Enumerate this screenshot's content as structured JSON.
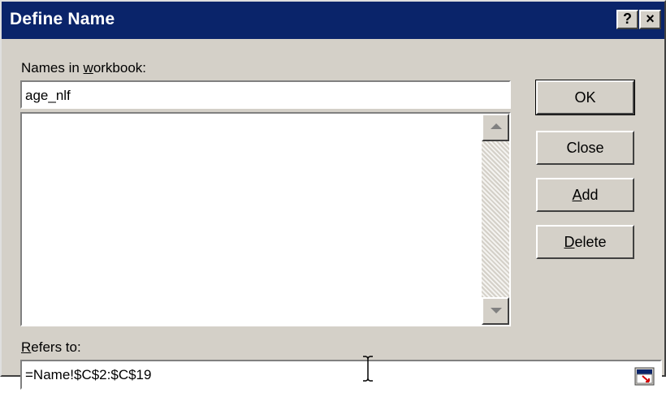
{
  "dialog": {
    "title": "Define Name",
    "help_button": "?",
    "close_button": "×"
  },
  "names_label": {
    "before": "Names in ",
    "accel": "w",
    "after": "orkbook:"
  },
  "name_input": {
    "value": "age_nlf"
  },
  "names_list": {
    "items": []
  },
  "buttons": {
    "ok": "OK",
    "close": "Close",
    "add": {
      "accel": "A",
      "rest": "dd"
    },
    "delete": {
      "accel": "D",
      "rest": "elete"
    }
  },
  "refers_label": {
    "accel": "R",
    "rest": "efers to:"
  },
  "refers_input": {
    "value": "=Name!$C$2:$C$19"
  },
  "colors": {
    "titlebar": "#0a246a",
    "dialog_bg": "#d4d0c8",
    "field_bg": "#ffffff"
  }
}
